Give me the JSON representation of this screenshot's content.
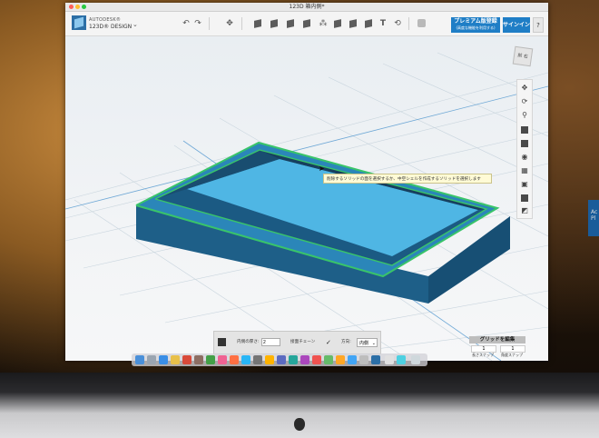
{
  "window": {
    "document_title": "123D 箱内側*",
    "brand_small": "AUTODESK®",
    "brand_name": "123D® DESIGN"
  },
  "toolbar": {
    "premium_label": "プレミアム版登録",
    "premium_sublabel": "(高度な機能を利用する)",
    "signin_label": "サインイン",
    "help_label": "?"
  },
  "viewport": {
    "viewcube_front": "前",
    "viewcube_side": "右",
    "tooltip": "削除するソリッドの面を選択するか、中空シェルを作成するソリッドを選択します"
  },
  "shell_panel": {
    "thickness_label": "内側の厚さ:",
    "thickness_value": "2",
    "chain_label": "接面チェーン",
    "chain_checked": "✓",
    "direction_label": "方向:",
    "direction_value": "内側"
  },
  "grid_panel": {
    "edit_label": "グリッドを編集",
    "snap_value": "1",
    "angle_snap_value": "1",
    "snap_label": "長さスナップ",
    "angle_snap_label": "角度スナップ"
  },
  "colors": {
    "accent_blue": "#1f7ec6",
    "selection_green": "#39c46a",
    "solid_dark": "#1f6e9e",
    "solid_floor": "#4fb6e4"
  },
  "icons": {
    "tools": [
      "undo-icon",
      "redo-icon",
      "transform-icon",
      "primitives-icon",
      "sketch-icon",
      "construct-icon",
      "modify-icon",
      "pattern-icon",
      "grouping-icon",
      "combine-icon",
      "measure-icon",
      "text-icon",
      "snap-icon",
      "material-icon"
    ],
    "nav": [
      "pan-icon",
      "orbit-icon",
      "zoom-icon",
      "fit-icon",
      "view-solid-icon",
      "visibility-icon",
      "grid-icon",
      "camera-icon",
      "materials-icon",
      "outline-icon"
    ]
  },
  "right_peek_text": "Ac\nPl"
}
